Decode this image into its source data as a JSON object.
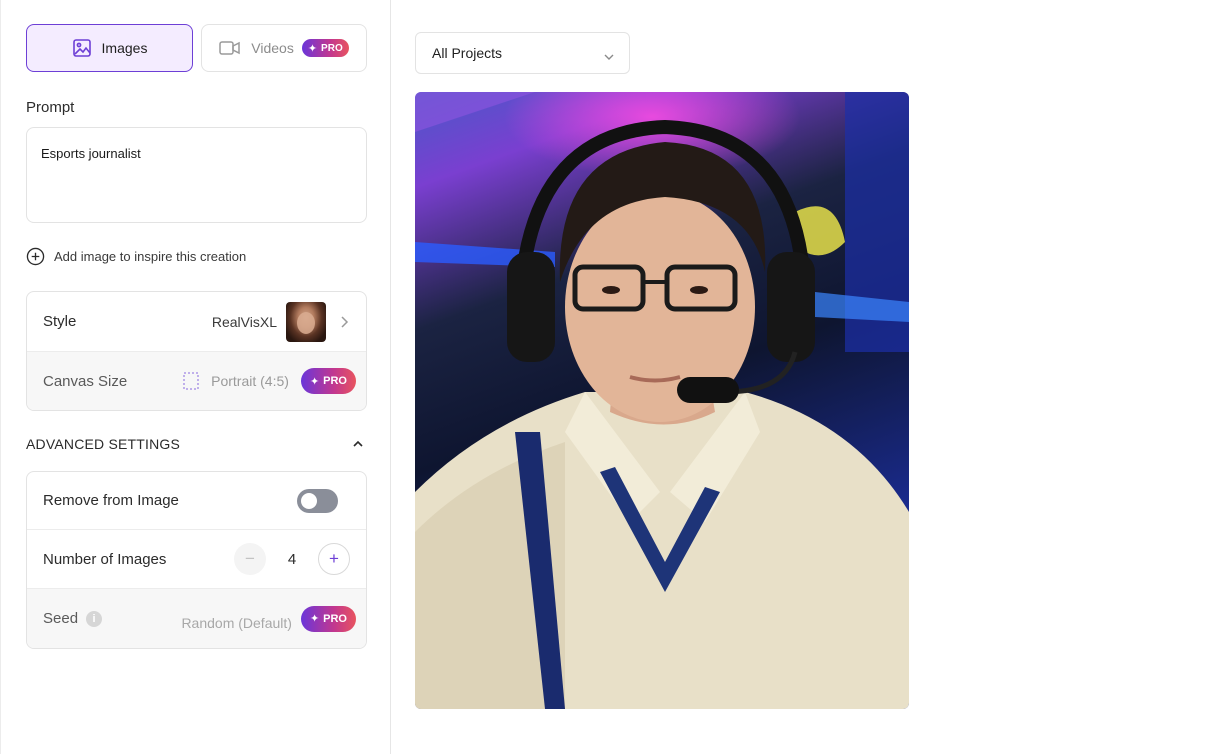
{
  "modes": {
    "images_label": "Images",
    "videos_label": "Videos",
    "pro_label": "PRO"
  },
  "prompt": {
    "label": "Prompt",
    "value": "Esports journalist"
  },
  "add_image_label": "Add image to inspire this creation",
  "style_card": {
    "style_label": "Style",
    "style_value": "RealVisXL",
    "canvas_label": "Canvas Size",
    "canvas_value": "Portrait (4:5)",
    "pro_label": "PRO"
  },
  "advanced": {
    "title": "ADVANCED SETTINGS",
    "remove_label": "Remove from Image",
    "remove_enabled": false,
    "number_label": "Number of Images",
    "number_value": "4",
    "seed_label": "Seed",
    "seed_value": "Random (Default)",
    "pro_label": "PRO"
  },
  "projects": {
    "selected": "All Projects"
  },
  "colors": {
    "accent": "#6d3fd6",
    "images_tab_bg": "#f4ecff",
    "pro_gradient_start": "#6a36d9",
    "pro_gradient_end": "#e8545f"
  }
}
